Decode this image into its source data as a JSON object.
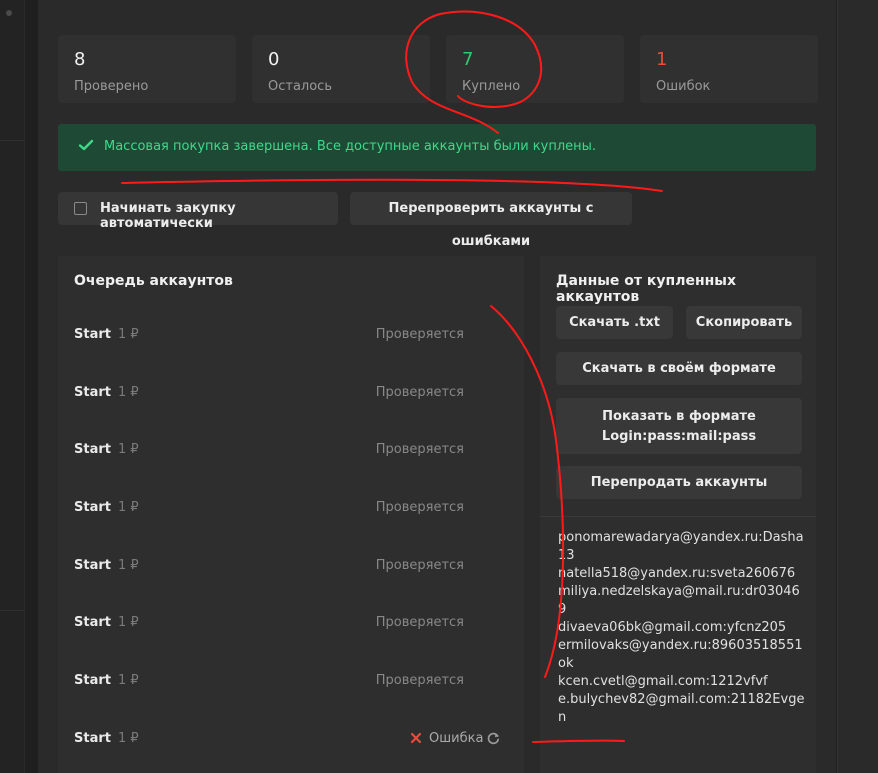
{
  "stats": [
    {
      "value": "8",
      "label": "Проверено"
    },
    {
      "value": "0",
      "label": "Осталось"
    },
    {
      "value": "7",
      "label": "Куплено"
    },
    {
      "value": "1",
      "label": "Ошибок"
    }
  ],
  "banner": {
    "text": "Массовая покупка завершена. Все доступные аккаунты были куплены."
  },
  "controls": {
    "auto_buy_label": "Начинать закупку автоматически",
    "auto_buy_checked": false,
    "recheck_label": "Перепроверить аккаунты с ошибками"
  },
  "queue": {
    "title": "Очередь аккаунтов",
    "rows": [
      {
        "name": "Start",
        "price": "1 ₽",
        "status": "Проверяется"
      },
      {
        "name": "Start",
        "price": "1 ₽",
        "status": "Проверяется"
      },
      {
        "name": "Start",
        "price": "1 ₽",
        "status": "Проверяется"
      },
      {
        "name": "Start",
        "price": "1 ₽",
        "status": "Проверяется"
      },
      {
        "name": "Start",
        "price": "1 ₽",
        "status": "Проверяется"
      },
      {
        "name": "Start",
        "price": "1 ₽",
        "status": "Проверяется"
      },
      {
        "name": "Start",
        "price": "1 ₽",
        "status": "Проверяется"
      },
      {
        "name": "Start",
        "price": "1 ₽",
        "status": "Ошибка"
      }
    ]
  },
  "bought": {
    "title": "Данные от купленных аккаунтов",
    "download_txt": "Скачать .txt",
    "copy": "Скопировать",
    "download_custom": "Скачать в своём формате",
    "show_format": "Показать в формате Login:pass:mail:pass",
    "resell": "Перепродать аккаунты",
    "accounts": [
      "ponomarewadarya@yandex.ru:Dasha13",
      "natella518@yandex.ru:sveta260676",
      "miliya.nedzelskaya@mail.ru:dr030469",
      "divaeva06bk@gmail.com:yfcnz205",
      "ermilovaks@yandex.ru:89603518551ok",
      "kcen.cvetl@gmail.com:1212vfvf",
      "e.bulychev82@gmail.com:21182Evgen"
    ]
  },
  "colors": {
    "success": "#2ecc71",
    "error": "#e74c3c",
    "banner_bg": "#1e4a35",
    "annotation": "#ff0000"
  }
}
